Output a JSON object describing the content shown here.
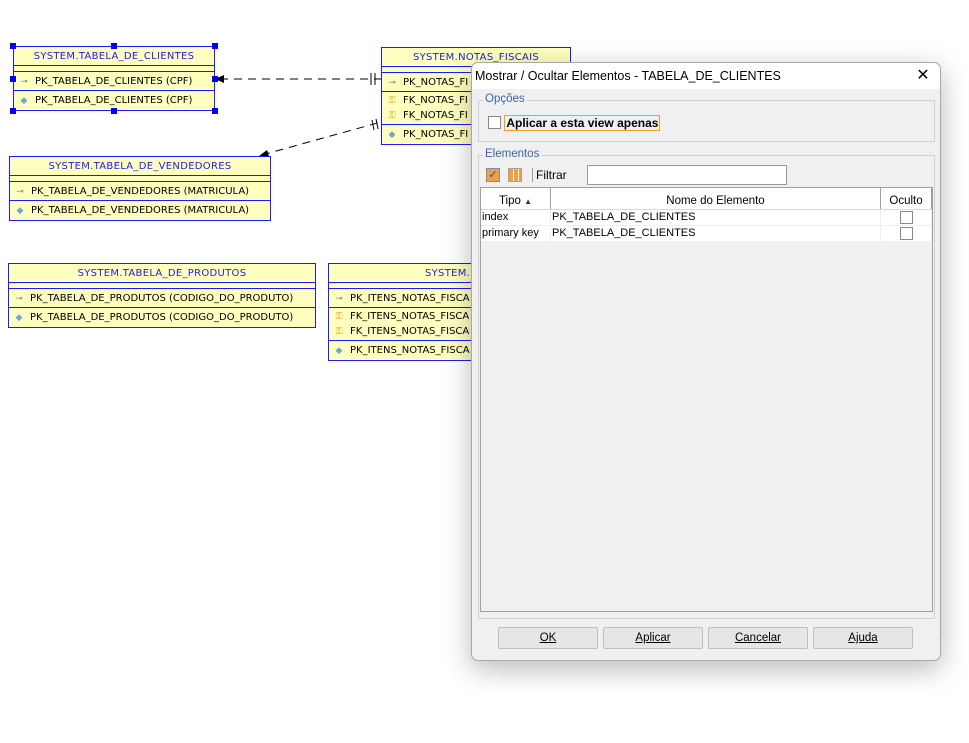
{
  "diagram": {
    "clientes": {
      "title": "SYSTEM.TABELA_DE_CLIENTES",
      "pk": "PK_TABELA_DE_CLIENTES (CPF)",
      "index": "PK_TABELA_DE_CLIENTES (CPF)"
    },
    "notas": {
      "title": "SYSTEM.NOTAS_FISCAIS",
      "pk": "PK_NOTAS_FI",
      "fk1": "FK_NOTAS_FI",
      "fk2": "FK_NOTAS_FI",
      "index": "PK_NOTAS_FI"
    },
    "vendedores": {
      "title": "SYSTEM.TABELA_DE_VENDEDORES",
      "pk": "PK_TABELA_DE_VENDEDORES (MATRICULA)",
      "index": "PK_TABELA_DE_VENDEDORES (MATRICULA)"
    },
    "produtos": {
      "title": "SYSTEM.TABELA_DE_PRODUTOS",
      "pk": "PK_TABELA_DE_PRODUTOS (CODIGO_DO_PRODUTO)",
      "index": "PK_TABELA_DE_PRODUTOS (CODIGO_DO_PRODUTO)"
    },
    "itens": {
      "title": "SYSTEM.I",
      "pk": "PK_ITENS_NOTAS_FISCA",
      "fk1": "FK_ITENS_NOTAS_FISCA",
      "fk2": "FK_ITENS_NOTAS_FISCA",
      "index": "PK_ITENS_NOTAS_FISCA"
    }
  },
  "dialog": {
    "title": "Mostrar / Ocultar Elementos - TABELA_DE_CLIENTES",
    "options_legend": "Opções",
    "apply_view_only": {
      "label": "Aplicar a esta view apenas",
      "checked": false
    },
    "elements_legend": "Elementos",
    "filter_label": "Filtrar",
    "filter_value": "",
    "columns": [
      "Tipo",
      "Nome do Elemento",
      "Oculto"
    ],
    "sort_icon": "sort-ascending-icon",
    "rows": [
      {
        "tipo": "index",
        "nome": "PK_TABELA_DE_CLIENTES",
        "oculto": false
      },
      {
        "tipo": "primary key",
        "nome": "PK_TABELA_DE_CLIENTES",
        "oculto": false
      }
    ],
    "buttons": {
      "ok": "OK",
      "apply": "Aplicar",
      "cancel": "Cancelar",
      "help": "Ajuda"
    }
  },
  "colors": {
    "table_fill": "#ffffc0",
    "table_border": "#1a1aff",
    "legend": "#3c64a8"
  }
}
